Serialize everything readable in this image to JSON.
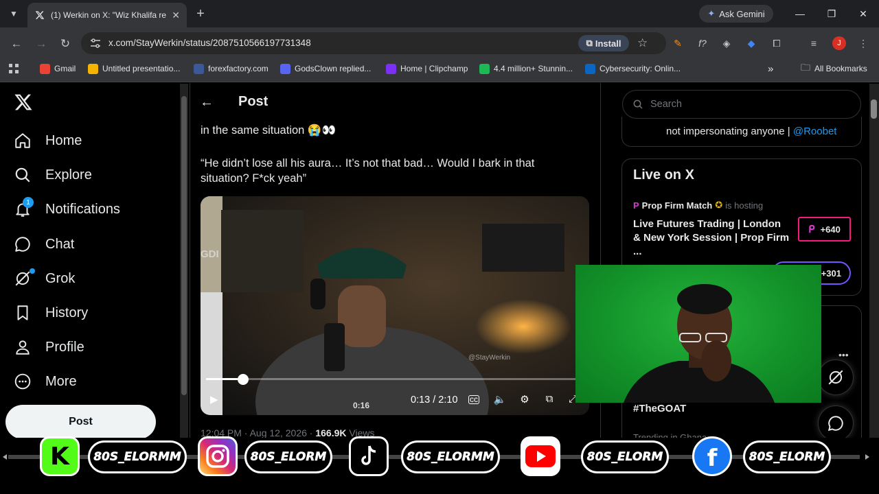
{
  "browser": {
    "tab_title": "(1) Werkin on X: \"Wiz Khalifa re",
    "url": "x.com/StayWerkin/status/2087510566197731348",
    "install_label": "Install",
    "gemini_label": "Ask Gemini",
    "profile_initial": "J",
    "bookmarks": [
      {
        "label": "Gmail",
        "color": "#ea4335"
      },
      {
        "label": "Untitled presentatio...",
        "color": "#f4b400"
      },
      {
        "label": "forexfactory.com",
        "color": "#3b5998"
      },
      {
        "label": "GodsClown replied...",
        "color": "#5865f2"
      },
      {
        "label": "Home | Clipchamp",
        "color": "#7b2ff7"
      },
      {
        "label": "4.4 million+ Stunnin...",
        "color": "#1db954"
      },
      {
        "label": "Cybersecurity: Onlin...",
        "color": "#0a66c2"
      }
    ],
    "all_bookmarks_label": "All Bookmarks"
  },
  "sidebar": {
    "items": [
      {
        "label": "Home",
        "icon": "home-icon"
      },
      {
        "label": "Explore",
        "icon": "search-icon"
      },
      {
        "label": "Notifications",
        "icon": "bell-icon"
      },
      {
        "label": "Chat",
        "icon": "chat-icon"
      },
      {
        "label": "Grok",
        "icon": "grok-icon"
      },
      {
        "label": "History",
        "icon": "bookmark-icon"
      },
      {
        "label": "Profile",
        "icon": "person-icon"
      },
      {
        "label": "More",
        "icon": "more-icon"
      }
    ],
    "notif_count": "1",
    "post_label": "Post"
  },
  "post": {
    "header_title": "Post",
    "line1": "in the same situation 😭👀",
    "quote": "“He didn’t lose all his aura… It’s not that bad… Would I bark in that situation? F*ck yeah”",
    "video_time": "0:13 / 2:10",
    "video_progress": 0.1,
    "video_caption": "0:16",
    "video_watermark": "@StayWerkin",
    "video_wall_text": "GDI",
    "meta_time": "12:04 PM · Aug 12, 2026 · ",
    "meta_views": "166.9K",
    "meta_views_label": " Views"
  },
  "right": {
    "search_placeholder": "Search",
    "bio_text": "not impersonating anyone | ",
    "bio_handle": "@Roobet",
    "live_title": "Live on X",
    "host_name": "Prop Firm Match",
    "host_status": "is hosting",
    "session_title": "Live Futures Trading | London & New York Session | Prop Firm ...",
    "listeners_1": "+640",
    "listeners_2": "+301",
    "trend_tag": "#TheGOAT",
    "trend_loc": "Trending in Ghana"
  },
  "banner": {
    "handle_1": "80S_ELORMM",
    "handle_2": "80S_ELORM",
    "handle_3": "80S_ELORMM",
    "handle_4": "80S_ELORM",
    "handle_5": "80S_ELORM"
  }
}
